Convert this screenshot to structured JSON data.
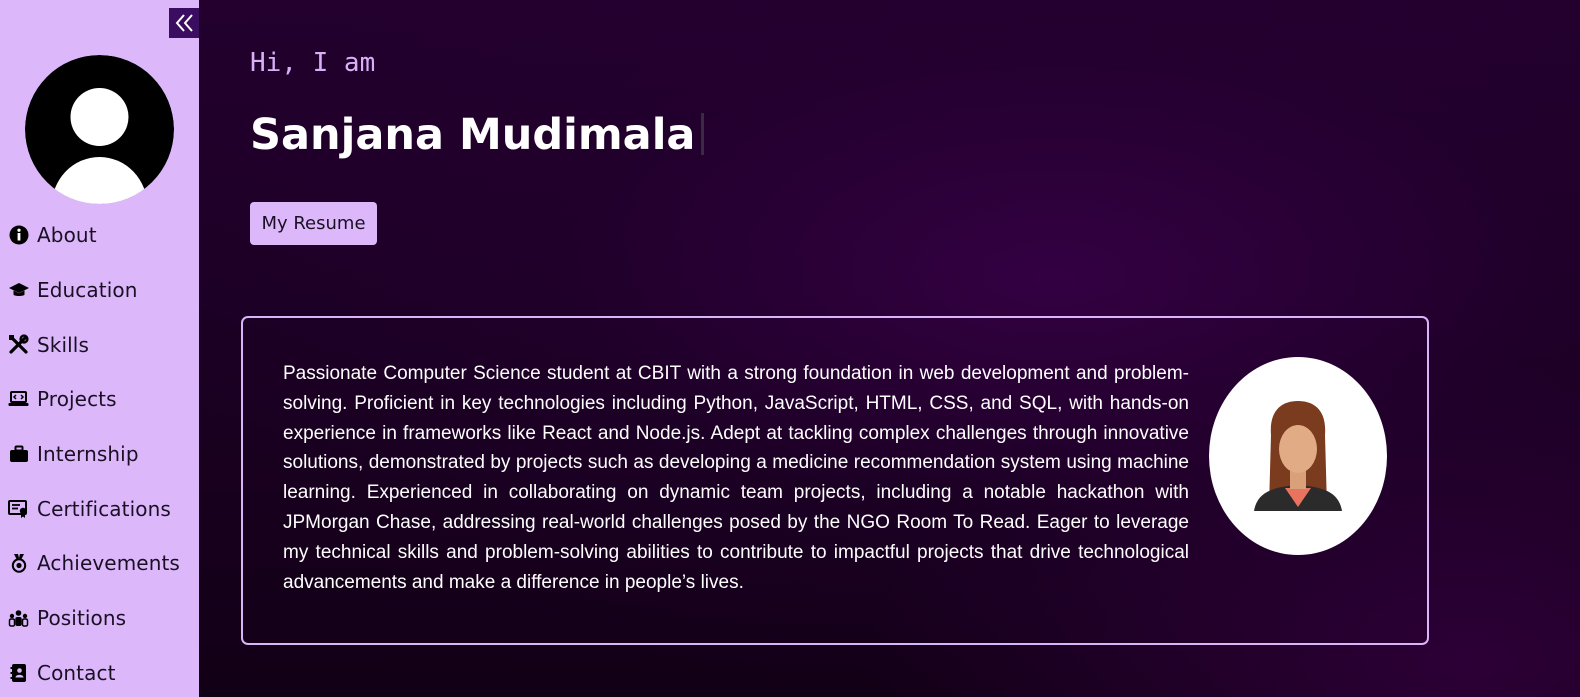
{
  "sidebar": {
    "items": [
      {
        "label": "About",
        "icon": "info-icon"
      },
      {
        "label": "Education",
        "icon": "graduation-cap-icon"
      },
      {
        "label": "Skills",
        "icon": "tools-icon"
      },
      {
        "label": "Projects",
        "icon": "laptop-code-icon"
      },
      {
        "label": "Internship",
        "icon": "briefcase-icon"
      },
      {
        "label": "Certifications",
        "icon": "certificate-icon"
      },
      {
        "label": "Achievements",
        "icon": "medal-icon"
      },
      {
        "label": "Positions",
        "icon": "people-group-icon"
      },
      {
        "label": "Contact",
        "icon": "address-book-icon"
      }
    ]
  },
  "hero": {
    "greeting": "Hi, I am",
    "name": "Sanjana Mudimala",
    "resume_button": "My Resume"
  },
  "about": {
    "text": "Passionate Computer Science student at CBIT with a strong foundation in web development and problem-solving. Proficient in key technologies including Python, JavaScript, HTML, CSS, and SQL, with hands-on experience in frameworks like React and Node.js. Adept at tackling complex challenges through innovative solutions, demonstrated by projects such as developing a medicine recommendation system using machine learning. Experienced in collaborating on dynamic team projects, including a notable hackathon with JPMorgan Chase, addressing real-world challenges posed by the NGO Room To Read. Eager to leverage my technical skills and problem-solving abilities to contribute to impactful projects that drive technological advancements and make a difference in people’s lives."
  },
  "colors": {
    "sidebar_bg": "#dcb8fb",
    "accent_dark": "#3a0d60",
    "greeting": "#d9b0f7",
    "card_border": "#d8b4f8"
  }
}
